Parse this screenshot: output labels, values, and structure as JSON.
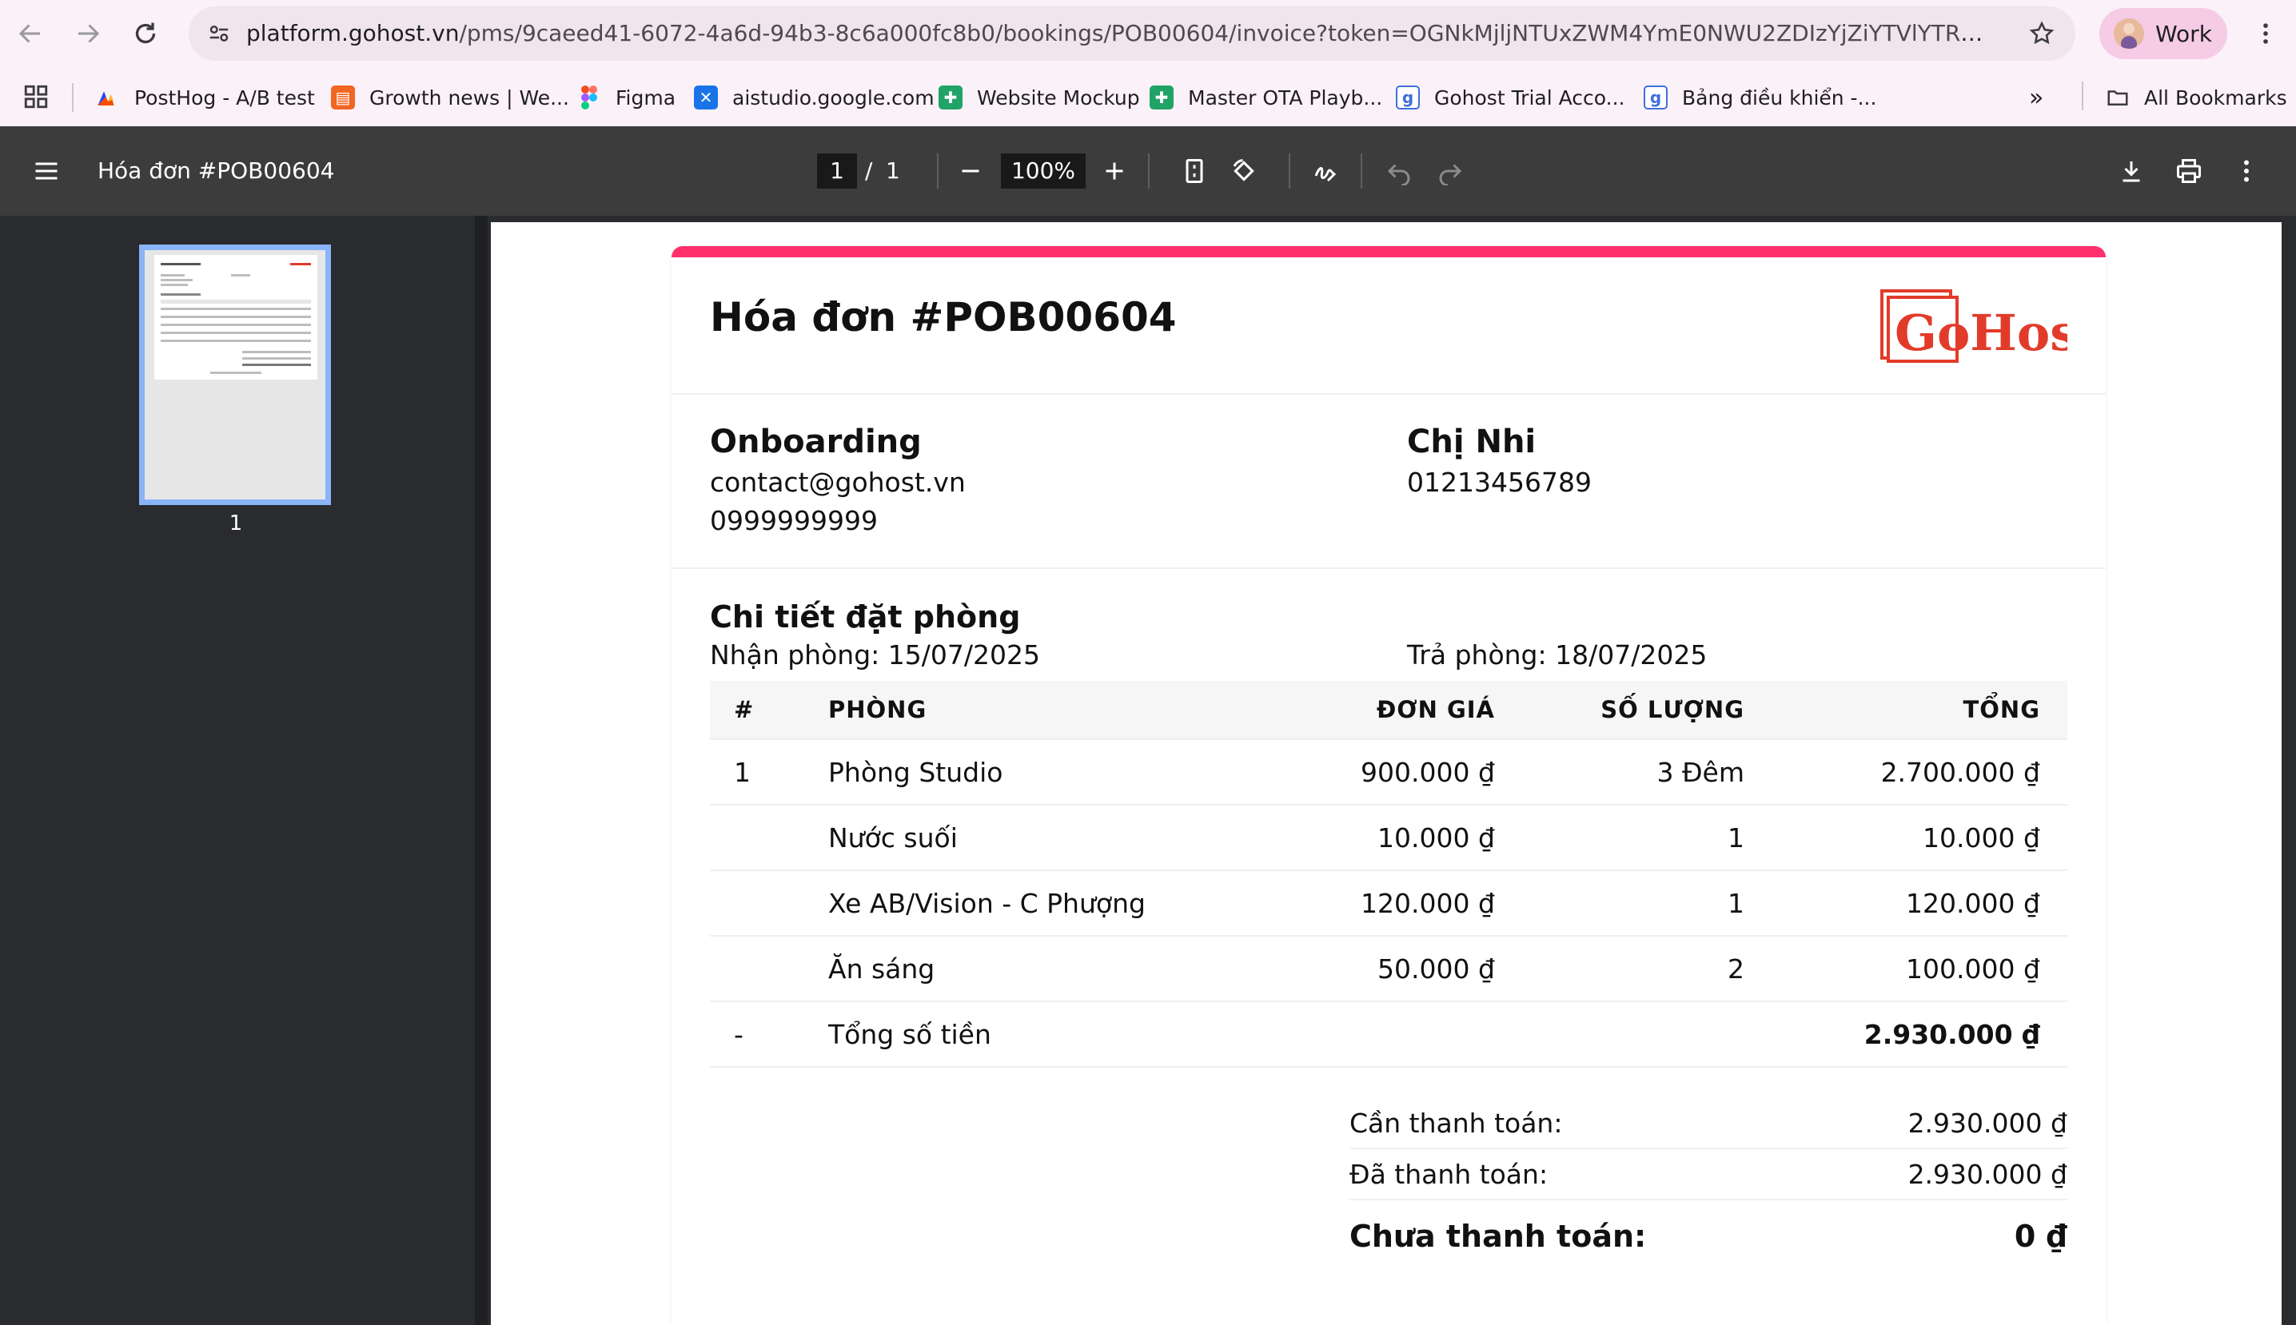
{
  "browser": {
    "url_host": "platform.gohost.vn",
    "url_path": "/pms/9caeed41-6072-4a6d-94b3-8c6a000fc8b0/bookings/POB00604/invoice?token=OGNkMjljNTUxZWM4YmE0NWU2ZDIzYjZiYTVlYTRjYzg5Y...",
    "profile_label": "Work",
    "bookmarks": [
      {
        "label": "PostHog - A/B test",
        "icon": "posthog-icon"
      },
      {
        "label": "Growth news | We...",
        "icon": "growth-news-icon"
      },
      {
        "label": "Figma",
        "icon": "figma-icon"
      },
      {
        "label": "aistudio.google.com",
        "icon": "aistudio-icon"
      },
      {
        "label": "Website Mockup",
        "icon": "sheets-icon"
      },
      {
        "label": "Master OTA Playb...",
        "icon": "sheets-icon"
      },
      {
        "label": "Gohost Trial Acco...",
        "icon": "gohost-icon"
      },
      {
        "label": "Bảng điều khiển -...",
        "icon": "gohost-icon"
      }
    ],
    "all_bookmarks_label": "All Bookmarks"
  },
  "viewer": {
    "doc_title": "Hóa đơn #POB00604",
    "current_page": "1",
    "page_sep": "/",
    "total_pages": "1",
    "zoom": "100%",
    "thumb_page_number": "1"
  },
  "invoice": {
    "title": "Hóa đơn #POB00604",
    "logo_text": "GoHost",
    "accent": "#ff2f6b",
    "logo_color": "#e23b2a",
    "seller": {
      "name": "Onboarding",
      "email": "contact@gohost.vn",
      "phone": "0999999999"
    },
    "guest": {
      "name": "Chị Nhi",
      "phone": "01213456789"
    },
    "details_heading": "Chi tiết đặt phòng",
    "checkin": "Nhận phòng: 15/07/2025",
    "checkout": "Trả phòng: 18/07/2025",
    "table": {
      "headers": {
        "no": "#",
        "room": "PHÒNG",
        "price": "ĐƠN GIÁ",
        "qty": "SỐ LƯỢNG",
        "total": "TỔNG"
      },
      "rows": [
        {
          "no": "1",
          "room": "Phòng Studio",
          "price": "900.000 ₫",
          "qty": "3 Đêm",
          "total": "2.700.000 ₫"
        },
        {
          "no": "",
          "room": "Nước suối",
          "price": "10.000 ₫",
          "qty": "1",
          "total": "10.000 ₫"
        },
        {
          "no": "",
          "room": "Xe AB/Vision - C Phượng",
          "price": "120.000 ₫",
          "qty": "1",
          "total": "120.000 ₫"
        },
        {
          "no": "",
          "room": "Ăn sáng",
          "price": "50.000 ₫",
          "qty": "2",
          "total": "100.000 ₫"
        }
      ],
      "sum_row": {
        "no": "-",
        "label": "Tổng số tiền",
        "total": "2.930.000 ₫"
      }
    },
    "summary": {
      "due_label": "Cần thanh toán:",
      "due_value": "2.930.000 ₫",
      "paid_label": "Đã thanh toán:",
      "paid_value": "2.930.000 ₫",
      "unpaid_label": "Chưa thanh toán:",
      "unpaid_value": "0 ₫"
    }
  }
}
